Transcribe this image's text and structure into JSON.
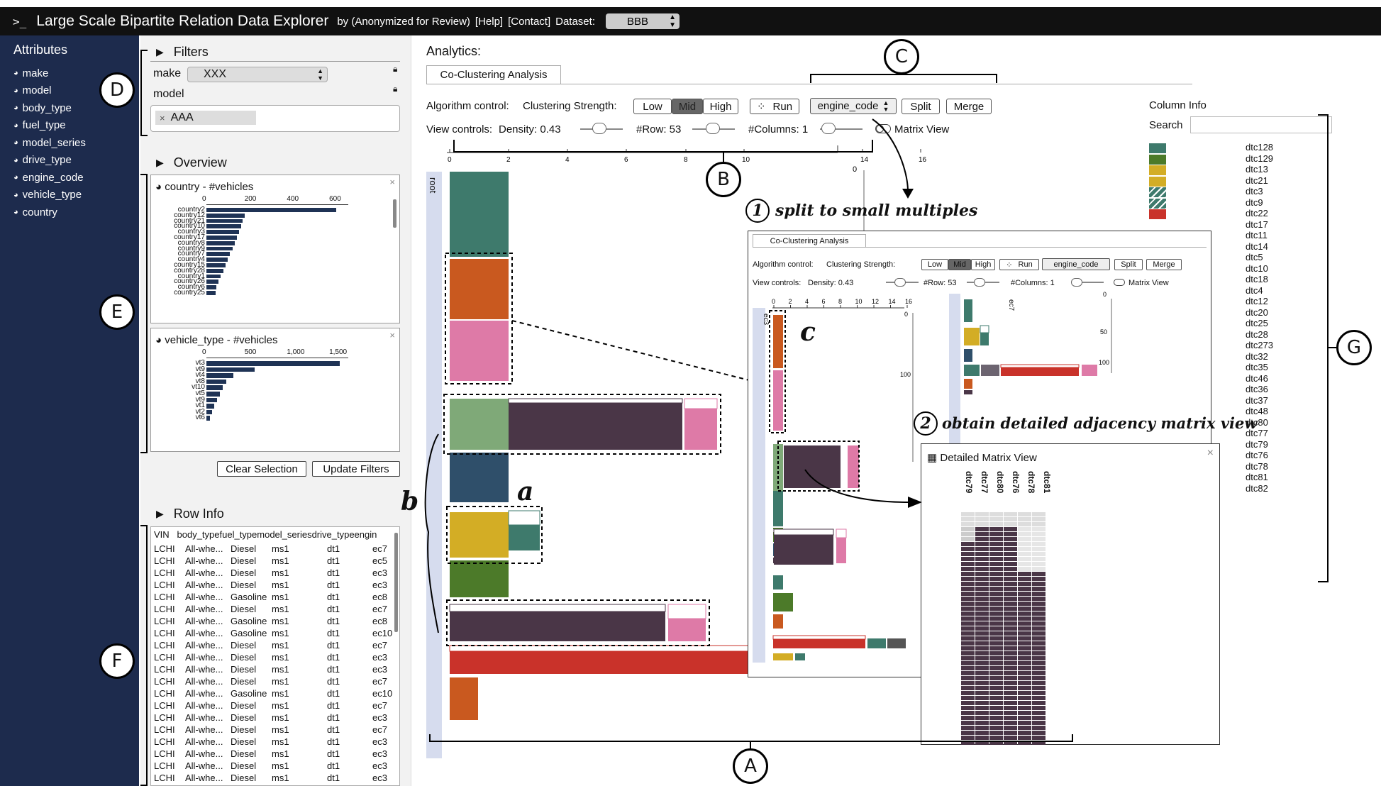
{
  "app": {
    "prompt": ">_",
    "title": "Large Scale Bipartite Relation Data Explorer",
    "by": "by (Anonymized for Review)",
    "help": "[Help]",
    "contact": "[Contact]",
    "dataset_label": "Dataset:",
    "dataset_value": "BBB"
  },
  "sidebar": {
    "heading": "Attributes",
    "items": [
      "make",
      "model",
      "body_type",
      "fuel_type",
      "model_series",
      "drive_type",
      "engine_code",
      "vehicle_type",
      "country"
    ]
  },
  "filters": {
    "heading": "Filters",
    "make_label": "make",
    "make_value": "XXX",
    "model_label": "model",
    "model_tag": "AAA",
    "tag_remove": "×"
  },
  "overview": {
    "heading": "Overview",
    "country_chart": {
      "title": "country - #vehicles",
      "ticks": [
        "0",
        "200",
        "400",
        "600"
      ],
      "categories": [
        "country2",
        "country12",
        "country21",
        "country10",
        "country3",
        "country17",
        "country8",
        "country9",
        "country7",
        "country4",
        "country15",
        "country28",
        "country1",
        "country26",
        "country6",
        "country25"
      ],
      "values": [
        640,
        190,
        180,
        170,
        160,
        150,
        140,
        130,
        115,
        105,
        95,
        85,
        70,
        60,
        50,
        45
      ]
    },
    "vehicle_chart": {
      "title": "vehicle_type - #vehicles",
      "ticks": [
        "0",
        "500",
        "1,000",
        "1,500"
      ],
      "categories": [
        "vt3",
        "vt9",
        "vt4",
        "vt8",
        "vt10",
        "vt5",
        "vt9",
        "vt1",
        "vt2",
        "vt6"
      ],
      "values": [
        1500,
        540,
        300,
        220,
        180,
        150,
        120,
        90,
        60,
        40
      ]
    },
    "close": "×",
    "clear_button": "Clear Selection",
    "update_button": "Update Filters"
  },
  "row_info": {
    "heading": "Row Info",
    "columns": [
      "VIN",
      "body_type",
      "fuel_type",
      "model_series",
      "drive_type",
      "engine_code"
    ],
    "column_header_text": "VIN   body_typefuel_typemodel_seriesdrive_typeengin",
    "rows": [
      [
        "LCHI",
        "All-whe...",
        "Diesel",
        "ms1",
        "dt1",
        "ec7"
      ],
      [
        "LCHI",
        "All-whe...",
        "Diesel",
        "ms1",
        "dt1",
        "ec5"
      ],
      [
        "LCHI",
        "All-whe...",
        "Diesel",
        "ms1",
        "dt1",
        "ec3"
      ],
      [
        "LCHI",
        "All-whe...",
        "Diesel",
        "ms1",
        "dt1",
        "ec3"
      ],
      [
        "LCHI",
        "All-whe...",
        "Gasoline",
        "ms1",
        "dt1",
        "ec8"
      ],
      [
        "LCHI",
        "All-whe...",
        "Diesel",
        "ms1",
        "dt1",
        "ec7"
      ],
      [
        "LCHI",
        "All-whe...",
        "Gasoline",
        "ms1",
        "dt1",
        "ec8"
      ],
      [
        "LCHI",
        "All-whe...",
        "Gasoline",
        "ms1",
        "dt1",
        "ec10"
      ],
      [
        "LCHI",
        "All-whe...",
        "Diesel",
        "ms1",
        "dt1",
        "ec7"
      ],
      [
        "LCHI",
        "All-whe...",
        "Diesel",
        "ms1",
        "dt1",
        "ec3"
      ],
      [
        "LCHI",
        "All-whe...",
        "Diesel",
        "ms1",
        "dt1",
        "ec3"
      ],
      [
        "LCHI",
        "All-whe...",
        "Diesel",
        "ms1",
        "dt1",
        "ec7"
      ],
      [
        "LCHI",
        "All-whe...",
        "Gasoline",
        "ms1",
        "dt1",
        "ec10"
      ],
      [
        "LCHI",
        "All-whe...",
        "Diesel",
        "ms1",
        "dt1",
        "ec7"
      ],
      [
        "LCHI",
        "All-whe...",
        "Diesel",
        "ms1",
        "dt1",
        "ec3"
      ],
      [
        "LCHI",
        "All-whe...",
        "Diesel",
        "ms1",
        "dt1",
        "ec7"
      ],
      [
        "LCHI",
        "All-whe...",
        "Diesel",
        "ms1",
        "dt1",
        "ec3"
      ],
      [
        "LCHI",
        "All-whe...",
        "Diesel",
        "ms1",
        "dt1",
        "ec3"
      ],
      [
        "LCHI",
        "All-whe...",
        "Diesel",
        "ms1",
        "dt1",
        "ec3"
      ],
      [
        "LCHI",
        "All-whe...",
        "Diesel",
        "ms1",
        "dt1",
        "ec3"
      ],
      [
        "LCHI",
        "All-whe...",
        "Diesel",
        "ms1",
        "dt1",
        "ec3"
      ]
    ]
  },
  "analytics": {
    "heading": "Analytics:",
    "tab": "Co-Clustering Analysis",
    "algo_label": "Algorithm control:",
    "strength_label": "Clustering Strength:",
    "low": "Low",
    "mid": "Mid",
    "high": "High",
    "run": "Run",
    "run_icon": "⁘",
    "attr_select": "engine_code",
    "split": "Split",
    "merge": "Merge",
    "view_label": "View controls:",
    "density": "Density: 0.43",
    "rows": "#Row: 53",
    "columns": "#Columns: 1",
    "matrix_view": "Matrix View",
    "axis_ticks": [
      "0",
      "2",
      "4",
      "6",
      "8",
      "10",
      "14",
      "16"
    ],
    "root_label": "root",
    "right_axis_zero": "0"
  },
  "inset": {
    "tab": "Co-Clustering Analysis",
    "algo_label": "Algorithm control:",
    "strength_label": "Clustering Strength:",
    "low": "Low",
    "mid": "Mid",
    "high": "High",
    "run": "Run",
    "attr_select": "engine_code",
    "split": "Split",
    "merge": "Merge",
    "view_label": "View controls:",
    "density": "Density: 0.43",
    "rows": "#Row: 53",
    "columns": "#Columns: 1",
    "matrix_view": "Matrix View",
    "ticks": [
      "0",
      "2",
      "4",
      "6",
      "8",
      "10",
      "12",
      "14",
      "16"
    ],
    "ec3": "ec3",
    "ec7": "ec7",
    "y0": "0",
    "y100": "100",
    "y50": "50",
    "y100b": "100",
    "y0b": "0"
  },
  "matrix": {
    "title": "Detailed Matrix View",
    "icon": "▦",
    "close": "×",
    "columns": [
      "dtc79",
      "dtc77",
      "dtc80",
      "dtc76",
      "dtc78",
      "dtc81"
    ]
  },
  "column_info": {
    "heading": "Column Info",
    "search_label": "Search",
    "items": [
      "dtc128",
      "dtc129",
      "dtc13",
      "dtc21",
      "dtc3",
      "dtc9",
      "dtc22",
      "dtc17",
      "dtc11",
      "dtc14",
      "dtc5",
      "dtc10",
      "dtc18",
      "dtc4",
      "dtc12",
      "dtc20",
      "dtc25",
      "dtc28",
      "dtc273",
      "dtc32",
      "dtc35",
      "dtc46",
      "dtc36",
      "dtc37",
      "dtc48",
      "dtc80",
      "dtc77",
      "dtc79",
      "dtc76",
      "dtc78",
      "dtc81",
      "dtc82"
    ],
    "swatch_colors": [
      "#3e7a6c",
      "#4c7a29",
      "#d3ad25",
      "#d3ad25",
      "#3e7a6c",
      "#3e7a6c",
      "#c9322a"
    ]
  },
  "annotations": {
    "A": "A",
    "B": "B",
    "C": "C",
    "D": "D",
    "E": "E",
    "F": "F",
    "G": "G",
    "a": "a",
    "b": "b",
    "c": "c",
    "step1_num": "1",
    "step1_text": "split to small multiples",
    "step2_num": "2",
    "step2_text": "obtain detailed adjacency matrix view"
  },
  "colors": {
    "dark_teal": "#3e7a6c",
    "orange": "#c9591f",
    "pink": "#de7aa7",
    "sage": "#7fa978",
    "plum": "#4a3647",
    "navy": "#2f4f6a",
    "mustard": "#d3ad25",
    "green": "#4c7a29",
    "red": "#c9322a",
    "sidebar_bg": "#1d2b4d"
  }
}
